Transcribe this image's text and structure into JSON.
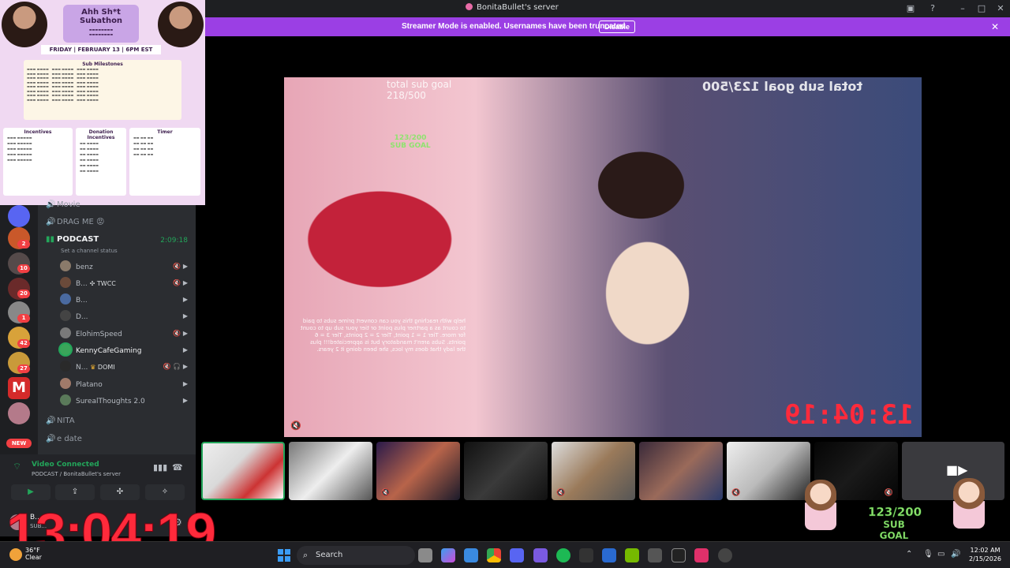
{
  "window": {
    "title": "BonitaBullet's server"
  },
  "banner": {
    "message": "Streamer Mode is enabled. Usernames have been truncated.",
    "disable_label": "Disable"
  },
  "poster": {
    "title_line1": "Ahh Sh*t",
    "title_line2": "Subathon",
    "date": "FRIDAY | FEBRUARY 13 | 6PM EST",
    "milestones_title": "Sub Milestones",
    "incentives_title": "Incentives",
    "donation_title": "Donation Incentives",
    "timer_title": "Timer"
  },
  "rail": {
    "badges": [
      "2",
      "10",
      "20",
      "1",
      "42",
      "27"
    ],
    "new_label": "NEW"
  },
  "channels": {
    "partial_top": "Movie",
    "drag_me": "DRAG ME 😡",
    "podcast": "PODCAST",
    "podcast_time": "2:09:18",
    "set_status": "Set a channel status",
    "members": [
      {
        "name": "benz",
        "color": "#8a7a6a"
      },
      {
        "name": "B...",
        "tag": "TWCC",
        "color": "#6a4a3a"
      },
      {
        "name": "B...",
        "color": "#4a6aa0"
      },
      {
        "name": "D...",
        "color": "#444"
      },
      {
        "name": "ElohimSpeed",
        "color": "#7a7a7a"
      },
      {
        "name": "KennyCafeGaming",
        "color": "#3aa55a"
      },
      {
        "name": "N...",
        "tag": "DOMI",
        "color": "#2a2a2a"
      },
      {
        "name": "Platano",
        "color": "#a07a6a"
      },
      {
        "name": "SurealThoughts 2.0",
        "color": "#5a7a5a"
      }
    ],
    "nita": "NITA",
    "edate": "e date"
  },
  "voice": {
    "status": "Video Connected",
    "server": "PODCAST / BonitaBullet's server"
  },
  "user": {
    "name": "B...",
    "status": "SUB..."
  },
  "stream": {
    "overlay_goal_left": "total sub goal",
    "overlay_goal_left_num": "218/500",
    "overlay_goal_right": "total sub goal 123/500",
    "counter": "123/200",
    "counter_label": "SUB GOAL",
    "clock": "13:04:19",
    "note": "help with reaching this you can convert prime subs to paid to count as a partner plus point or tier your sub up to count for more. Tier 1 = 1 point, Tier 2 = 2 points, Tier 3 = 6 points. Subs aren't mandatory but is appreciated!!! plus the lady that does my locs, she been doing it 2 years."
  },
  "goal_overlay": {
    "value": "123/200",
    "label": "SUB GOAL"
  },
  "big_clock": "13:04:19",
  "taskbar": {
    "weather_temp": "36°F",
    "weather_desc": "Clear",
    "search_placeholder": "Search",
    "time": "12:02 AM",
    "date": "2/15/2026"
  }
}
